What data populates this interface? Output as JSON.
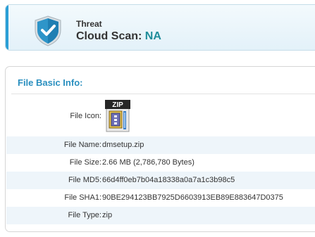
{
  "header": {
    "icon": "shield-check-icon",
    "threat_label": "Threat",
    "scan_label": "Cloud Scan:",
    "scan_value": "NA"
  },
  "panel": {
    "title": "File Basic Info:",
    "file_icon_label": "File Icon:",
    "file_icon": "zip-archive-icon",
    "file_icon_text": "ZIP",
    "rows": [
      {
        "label": "File Name:",
        "value": "dmsetup.zip"
      },
      {
        "label": "File Size:",
        "value": "2.66 MB (2,786,780 Bytes)"
      },
      {
        "label": "File MD5:",
        "value": "66d4ff0eb7b04a18338a0a7a1c3b98c5"
      },
      {
        "label": "File SHA1:",
        "value": "90BE294123BB7925D6603913EB89E883647D0375"
      },
      {
        "label": "File Type:",
        "value": "zip"
      }
    ]
  },
  "colors": {
    "accent": "#2b9fd6",
    "scan_value": "#1f8d9a",
    "title": "#2a8fbf",
    "row_shade": "#eef5fa"
  }
}
